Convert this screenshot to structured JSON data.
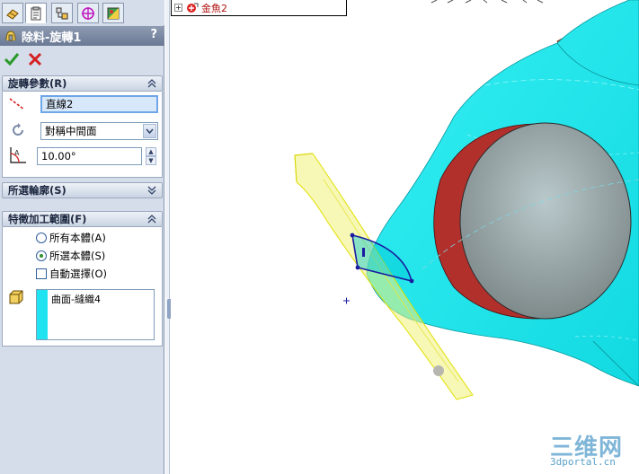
{
  "panel": {
    "tabs": [
      {
        "name": "featuremanager-tab-icon"
      },
      {
        "name": "propertymanager-tab-icon"
      },
      {
        "name": "configurationmanager-tab-icon"
      },
      {
        "name": "dimxpert-tab-icon"
      },
      {
        "name": "display-manager-tab-icon"
      }
    ],
    "title": "除料-旋轉1",
    "help": "?",
    "sections": {
      "revolve_params": {
        "header": "旋轉參數(R)",
        "axis_value": "直線2",
        "direction_value": "對稱中間面",
        "angle_value": "10.00°"
      },
      "selected_contours": {
        "header": "所選輪廓(S)"
      },
      "feature_scope": {
        "header": "特徵加工範圍(F)",
        "option_all": "所有本體(A)",
        "option_selected": "所選本體(S)",
        "option_auto": "自動選擇(O)",
        "selected_option": "所選本體(S)",
        "bodies": [
          "曲面-縫織4"
        ]
      }
    }
  },
  "tree_fragment": {
    "label": "金魚2"
  },
  "watermark": {
    "logo": "三维网",
    "url": "3dportal.cn"
  },
  "colors": {
    "body_cyan": "#1fe8ec",
    "eye_red": "#b8302e",
    "fin_orange": "#c9481c",
    "sketch_blue": "#1a1aa0",
    "preview_yellow": "#efef9a",
    "panel_bg": "#d4dde9"
  }
}
